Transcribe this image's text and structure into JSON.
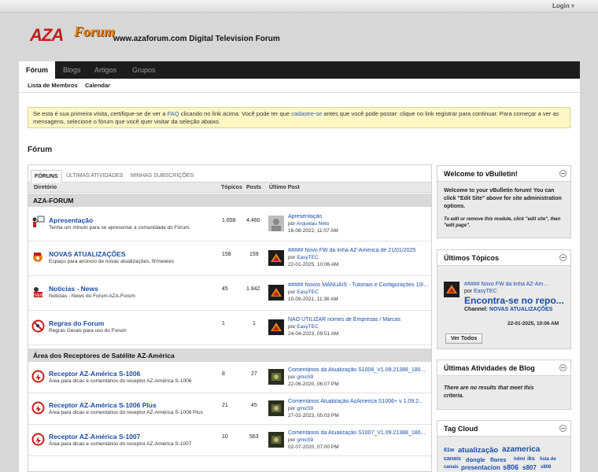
{
  "topbar": {
    "login_label": "Login"
  },
  "header": {
    "logo_aza": "AZA",
    "logo_forum": "Forum",
    "site_url": "www.azaforum.com",
    "tagline": "Digital Television Forum"
  },
  "nav": {
    "tabs": [
      {
        "label": "Fórum"
      },
      {
        "label": "Blogs"
      },
      {
        "label": "Artigos"
      },
      {
        "label": "Grupos"
      }
    ],
    "subtabs": [
      {
        "label": "Lista de Membros"
      },
      {
        "label": "Calendar"
      }
    ]
  },
  "notice": {
    "part1": "Se esta é sua primeira visita, certifique-se de ver a ",
    "faq_link": "FAQ",
    "part2": " clicando no link acima. Você pode ter que ",
    "register_link": "cadastre-se",
    "part3": " antes que você pode postar: clique no link registrar para continuar. Para começar a ver as mensagens, selecione o fórum que você quer visitar da seleção abaixo."
  },
  "page_title": "Fórum",
  "forum_tabs": [
    {
      "label": "FÓRUNS"
    },
    {
      "label": "ÚLTIMAS ATIVIDADES"
    },
    {
      "label": "MINHAS SUBSCRIÇÕES"
    }
  ],
  "columns": {
    "directory": "Diretório",
    "topics": "Tópicos",
    "posts": "Posts",
    "last_post": "Último Post"
  },
  "categories": [
    {
      "title": "AZA-FORUM"
    },
    {
      "title": "Área dos Receptores de Satélite AZ-América"
    }
  ],
  "forums": [
    {
      "title": "Apresentação",
      "description": "Tenha um minuto para se apresentar a comunidade do Fórum.",
      "topics": "1.658",
      "posts": "4.460",
      "last_title": "Apresentação",
      "by_label": "por",
      "last_user": "Arquelau Neto",
      "last_date": "16-08-2022, 11:07 AM",
      "icon": "presenter-icon"
    },
    {
      "title": "NOVAS ATUALIZAÇÕES",
      "description": "Espaço para anúncio de novas atualizações, firmwares",
      "topics": "158",
      "posts": "159",
      "last_title": "##### Novo FW da linha AZ-America de 21/01/2025",
      "by_label": "por",
      "last_user": "EasyTEC",
      "last_date": "22-01-2025, 10:06 AM",
      "icon": "update-icon"
    },
    {
      "title": "Noticias - News",
      "description": "Noticias - News do Forum AZA-Forum",
      "topics": "45",
      "posts": "1.842",
      "last_title": "##### Novos MANUAIS - Tutoriais e Configurações 10/...",
      "by_label": "por",
      "last_user": "EasyTEC",
      "last_date": "10-09-2021, 11:36 AM",
      "icon": "news-icon"
    },
    {
      "title": "Regras do Forum",
      "description": "Regras Gerais para uso do Forum",
      "topics": "1",
      "posts": "1",
      "last_title": "NÃO UTILIZAR nomes de Empresas / Marcas",
      "by_label": "por",
      "last_user": "EasyTEC",
      "last_date": "24-04-2023, 09:51 AM",
      "icon": "rules-icon"
    },
    {
      "title": "Receptor AZ-América S-1006",
      "description": "Área para dicas e comentários do receptor AZ-América S-1006",
      "topics": "8",
      "posts": "27",
      "last_title": "Comentários da Atualização S1006_V1.09.21388_180...",
      "by_label": "por",
      "last_user": "gmic59",
      "last_date": "22-06-2020, 06:07 PM",
      "icon": "receiver-icon"
    },
    {
      "title": "Receptor AZ-América S-1006 Plus",
      "description": "Área para dicas e comentários do receptor AZ-América S-1006 Plus",
      "topics": "21",
      "posts": "45",
      "last_title": "Comentários Atualização AzAmerica S1006+ v 1.09.2...",
      "by_label": "por",
      "last_user": "gmic59",
      "last_date": "27-02-2023, 05:03 PM",
      "icon": "receiver-icon"
    },
    {
      "title": "Receptor AZ-América S-1007",
      "description": "Área para dicas e comentários do receptor AZ-América S-1007",
      "topics": "10",
      "posts": "563",
      "last_title": "Comentários da Atualização S1007_V1.09.21388_180...",
      "by_label": "por",
      "last_user": "gmic59",
      "last_date": "02-07-2020, 07:00 PM",
      "icon": "receiver-icon"
    }
  ],
  "sidebar": {
    "welcome": {
      "title": "Welcome to vBulletin!",
      "body": "Welcome to your vBulletin forum! You can click \"Edit Site\" above for site administration options.",
      "note": "To edit or remove this module, click \"edit site\", then \"edit page\"."
    },
    "latest_topics": {
      "title": "Últimos Tópicos",
      "topic_title": "##### Novo FW da linha AZ-Am...",
      "by_label": "por",
      "user": "EasyTEC",
      "headline": "Encontra-se no repo...",
      "channel_label": "Channel:",
      "channel_name": "NOVAS ATUALIZAÇÕES",
      "date": "22-01-2025, 10:06 AM",
      "view_all": "Ver Todos"
    },
    "blog_activity": {
      "title": "Últimas Atividades de Blog",
      "empty": "There are no results that meet this criteria."
    },
    "tag_cloud": {
      "title": "Tag Cloud",
      "tags": [
        "61w",
        "atualização",
        "azamerica",
        "canais",
        "dongle",
        "flores",
        "hdmi",
        "iks",
        "lista de",
        "canais",
        "presentacion",
        "s806",
        "s807",
        "s808"
      ]
    }
  },
  "colors": {
    "nav_bg": "#1c1c1c",
    "link": "#1a4ea8",
    "notice_bg": "#fff7c6",
    "logo_red": "#c21d1d",
    "logo_orange": "#e2801a"
  }
}
